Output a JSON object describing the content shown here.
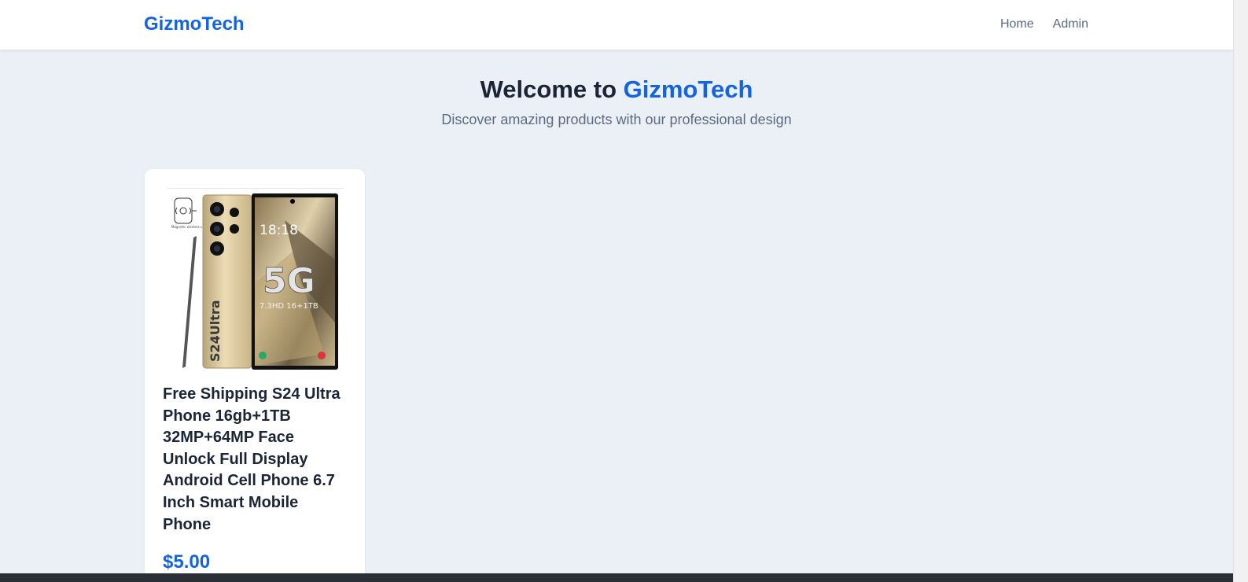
{
  "nav": {
    "brand": "GizmoTech",
    "links": [
      "Home",
      "Admin"
    ]
  },
  "hero": {
    "title_prefix": "Welcome to ",
    "title_brand": "GizmoTech",
    "subtitle": "Discover amazing products with our professional design"
  },
  "products": [
    {
      "title": "Free Shipping S24 Ultra Phone 16gb+1TB 32MP+64MP Face Unlock Full Display Android Cell Phone 6.7 Inch Smart Mobile Phone",
      "price": "$5.00",
      "image": {
        "clock": "18:18",
        "badge": "5G",
        "spec": "7.3HD 16+1TB",
        "model": "S24Ultra",
        "charger_label": "Magnetic wireless charger"
      }
    }
  ],
  "colors": {
    "accent": "#1463e0",
    "page_bg": "#ebf0f7",
    "text_dark": "#1b2535",
    "text_muted": "#5e6b7e"
  }
}
